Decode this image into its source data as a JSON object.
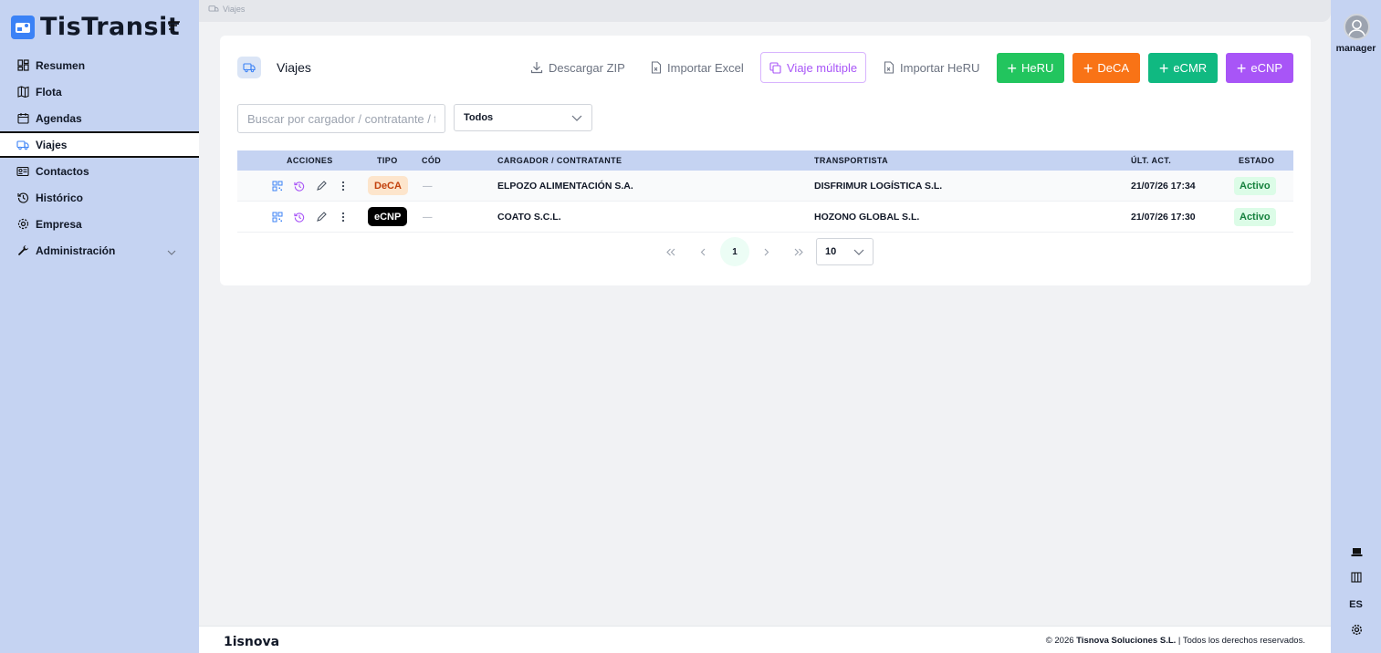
{
  "brand": {
    "name": "TisTransit"
  },
  "sidebar": {
    "items": [
      {
        "label": "Resumen",
        "icon": "dashboard-icon"
      },
      {
        "label": "Flota",
        "icon": "map-icon"
      },
      {
        "label": "Agendas",
        "icon": "calendar-icon"
      },
      {
        "label": "Viajes",
        "icon": "truck-icon",
        "active": true
      },
      {
        "label": "Contactos",
        "icon": "id-card-icon"
      },
      {
        "label": "Histórico",
        "icon": "history-icon"
      },
      {
        "label": "Empresa",
        "icon": "gear-icon"
      },
      {
        "label": "Administración",
        "icon": "wrench-icon"
      }
    ]
  },
  "breadcrumb": {
    "label": "Viajes"
  },
  "page": {
    "title": "Viajes"
  },
  "toolbar": {
    "download_zip": "Descargar ZIP",
    "import_excel": "Importar Excel",
    "multi_trip": "Viaje múltiple",
    "import_heru": "Importar HeRU",
    "create_buttons": [
      {
        "label": "HeRU",
        "color": "#22c55e"
      },
      {
        "label": "DeCA",
        "color": "#f97316"
      },
      {
        "label": "eCMR",
        "color": "#10b981"
      },
      {
        "label": "eCNP",
        "color": "#a855f7"
      }
    ]
  },
  "filters": {
    "search_placeholder": "Buscar por cargador / contratante / tr",
    "status_selected": "Todos"
  },
  "table": {
    "headers": {
      "actions": "ACCIONES",
      "type": "TIPO",
      "code": "CÓD",
      "shipper": "CARGADOR / CONTRATANTE",
      "carrier": "TRANSPORTISTA",
      "updated": "ÚLT. ACT.",
      "status": "ESTADO"
    },
    "rows": [
      {
        "type": "DeCA",
        "code": "—",
        "shipper": "ELPOZO ALIMENTACIÓN S.A.",
        "carrier": "DISFRIMUR LOGÍSTICA S.L.",
        "updated": "21/07/26 17:34",
        "status": "Activo"
      },
      {
        "type": "eCNP",
        "code": "—",
        "shipper": "COATO S.C.L.",
        "carrier": "HOZONO GLOBAL S.L.",
        "updated": "21/07/26 17:30",
        "status": "Activo"
      }
    ]
  },
  "pagination": {
    "current_page": "1",
    "page_size": "10"
  },
  "user": {
    "name": "manager"
  },
  "rail": {
    "language": "ES"
  },
  "footer": {
    "logo": "1isnova",
    "copyright_prefix": "© 2026",
    "company": "Tisnova Soluciones S.L.",
    "rights": "| Todos los derechos reservados."
  }
}
